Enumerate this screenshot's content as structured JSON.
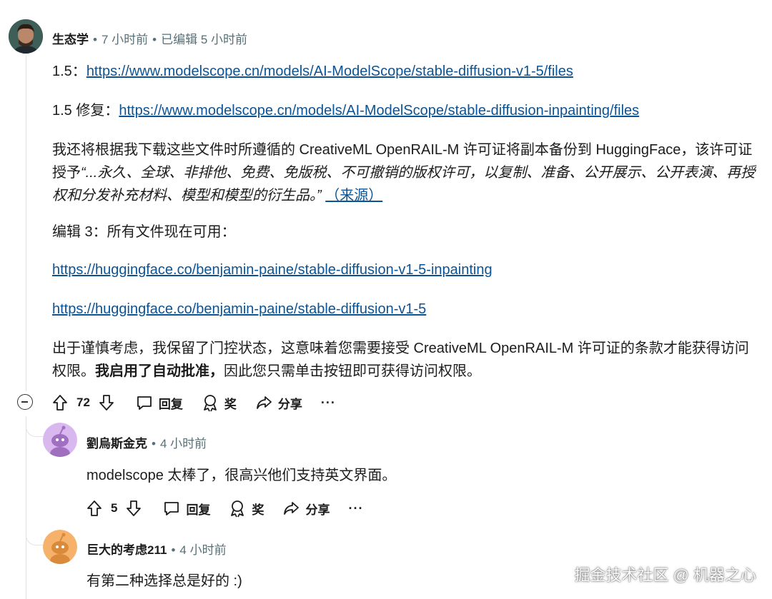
{
  "post": {
    "author": "生态学",
    "time": "7 小时前",
    "edited": "已编辑 5 小时前",
    "line1_label": "1.5：",
    "line1_link": "https://www.modelscope.cn/models/AI-ModelScope/stable-diffusion-v1-5/files",
    "line2_label": "1.5 修复：",
    "line2_link": "https://www.modelscope.cn/models/AI-ModelScope/stable-diffusion-inpainting/files",
    "para1_a": "我还将根据我下载这些文件时所遵循的 CreativeML OpenRAIL-M 许可证将副本备份到 HuggingFace，该许可证授予",
    "para1_quote": "“...永久、全球、非排他、免费、免版税、不可撤销的版权许可，以复制、准备、公开展示、公开表演、再授权和分发补充材料、模型和模型的衍生品。”",
    "para1_source": "（来源）",
    "edit3": "编辑 3：所有文件现在可用：",
    "hf_link1": "https://huggingface.co/benjamin-paine/stable-diffusion-v1-5-inpainting",
    "hf_link2": "https://huggingface.co/benjamin-paine/stable-diffusion-v1-5",
    "para2_a": "出于谨慎考虑，我保留了门控状态，这意味着您需要接受 CreativeML OpenRAIL-M 许可证的条款才能获得访问权限。",
    "para2_bold": "我启用了自动批准，",
    "para2_b": "因此您只需单击按钮即可获得访问权限。",
    "votes": "72",
    "reply": "回复",
    "award": "奖",
    "share": "分享",
    "more": "···"
  },
  "comment1": {
    "author": "劉烏斯金克",
    "time": "4 小时前",
    "body": "modelscope 太棒了，很高兴他们支持英文界面。",
    "votes": "5",
    "reply": "回复",
    "award": "奖",
    "share": "分享",
    "more": "···",
    "avatar_color": "#d9b8f0"
  },
  "comment2": {
    "author": "巨大的考虑211",
    "time": "4 小时前",
    "body": "有第二种选择总是好的 :)",
    "avatar_color": "#f6b26b"
  },
  "watermark": "掘金技术社区 @ 机器之心"
}
